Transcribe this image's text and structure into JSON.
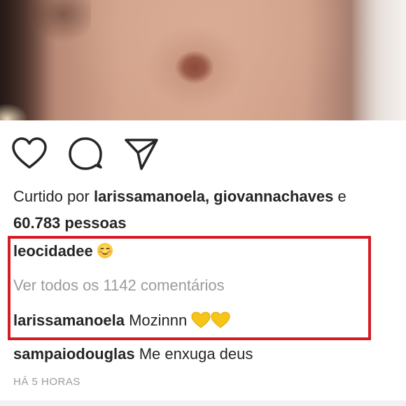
{
  "post": {
    "image_alt": "",
    "liked_prefix": "Curtido por ",
    "liked_users": "larissamanoela, giovannachaves",
    "liked_suffix": " e",
    "likes_count": "60.783 pessoas",
    "caption": {
      "username": "leocidadee",
      "emoji": "smiling-face-with-blush"
    },
    "view_all_comments": "Ver todos os 1142 comentários",
    "comments": [
      {
        "username": "larissamanoela",
        "text": "Mozinnn",
        "emoji": "yellow-heart x2"
      },
      {
        "username": "sampaiodouglas",
        "text": "Me enxuga deus"
      }
    ],
    "timestamp": "HÁ 5 HORAS"
  },
  "colors": {
    "highlight": "#d41c24",
    "text": "#262626",
    "muted": "#9b9b9b",
    "heart_yellow": "#f5c518"
  },
  "icons": {
    "like": "heart-outline-icon",
    "comment": "comment-bubble-icon",
    "share": "paper-plane-icon"
  }
}
